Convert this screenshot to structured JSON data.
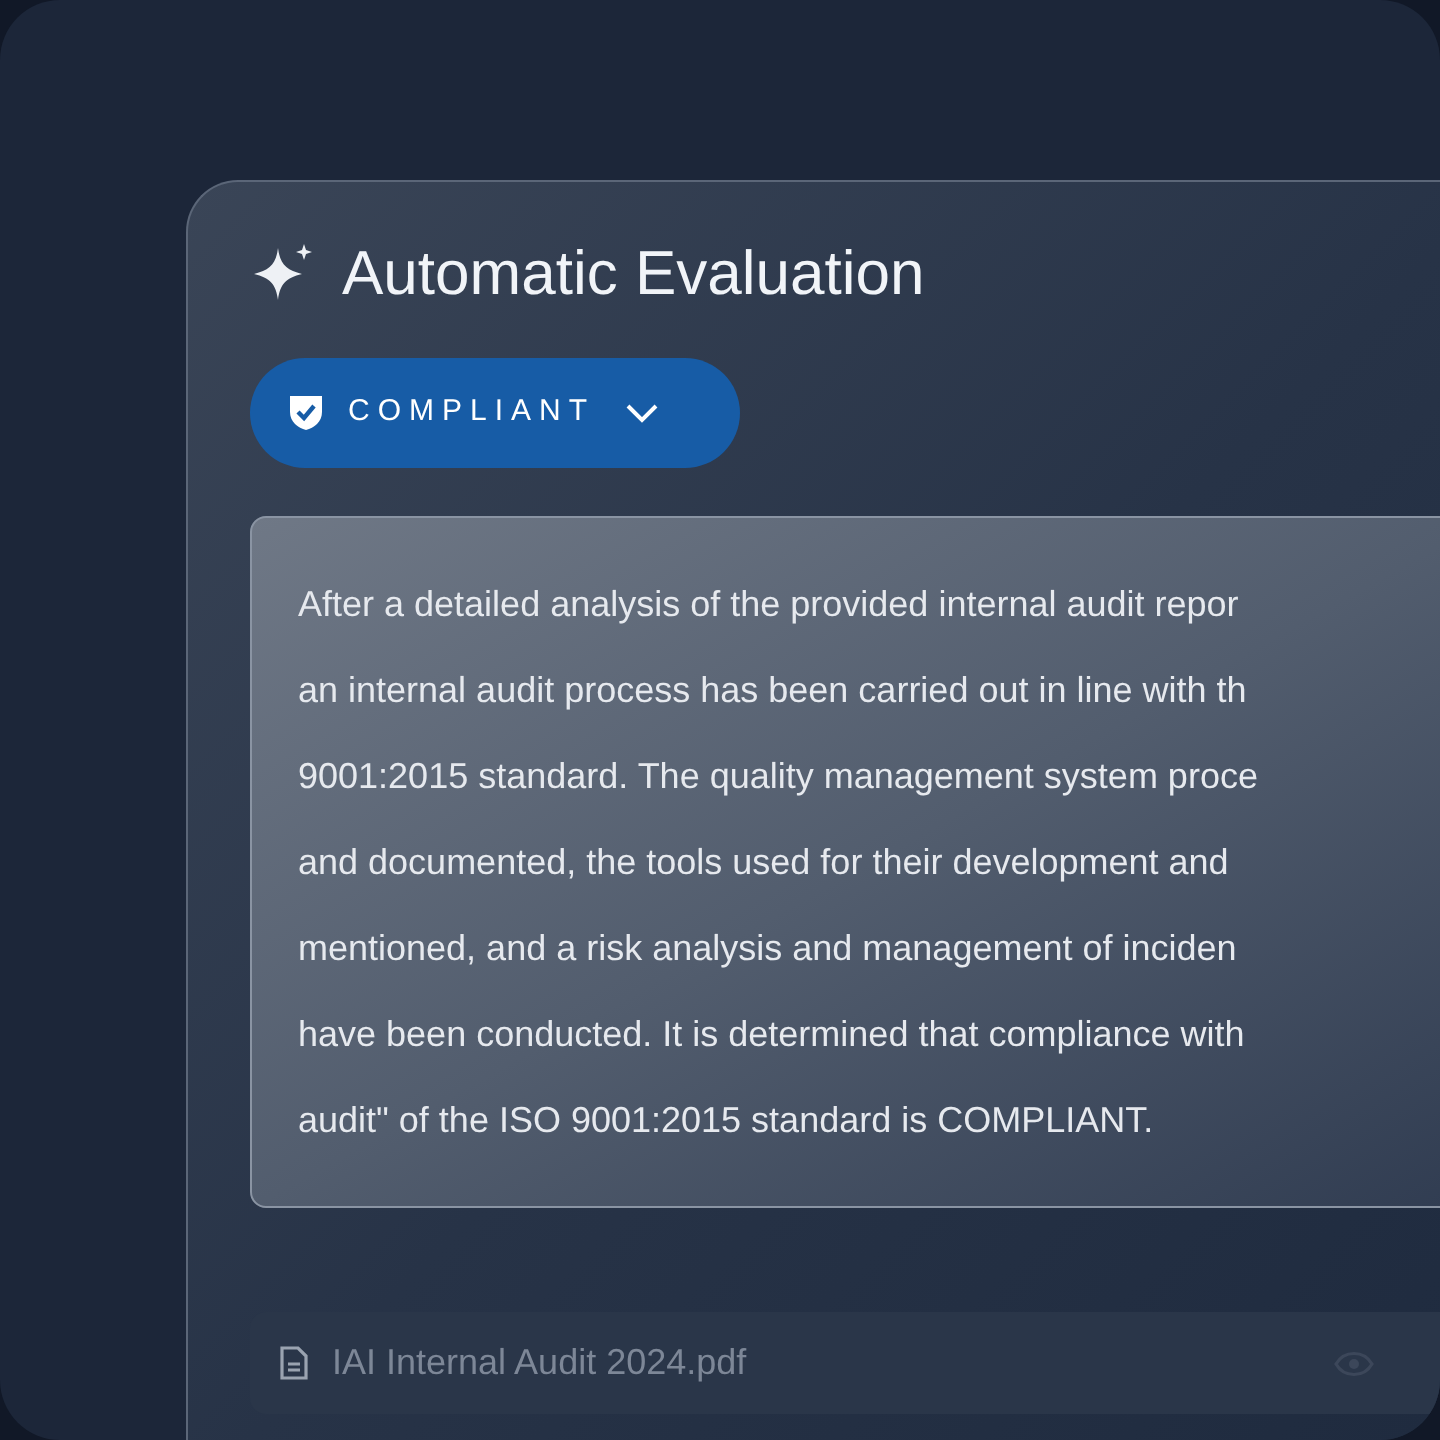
{
  "panel": {
    "title": "Automatic Evaluation",
    "status": {
      "label": "COMPLIANT"
    },
    "summary": {
      "lines": [
        "After a detailed analysis of the provided internal audit repor",
        "an internal audit process has been carried out in line with th",
        "9001:2015 standard. The quality management system proce",
        "and documented, the tools used for their development and",
        "mentioned, and a risk analysis and management of inciden",
        "have been conducted. It is determined that compliance with",
        "audit\" of the ISO 9001:2015 standard is COMPLIANT."
      ]
    },
    "attachment": {
      "name": "IAI Internal Audit 2024.pdf"
    }
  }
}
